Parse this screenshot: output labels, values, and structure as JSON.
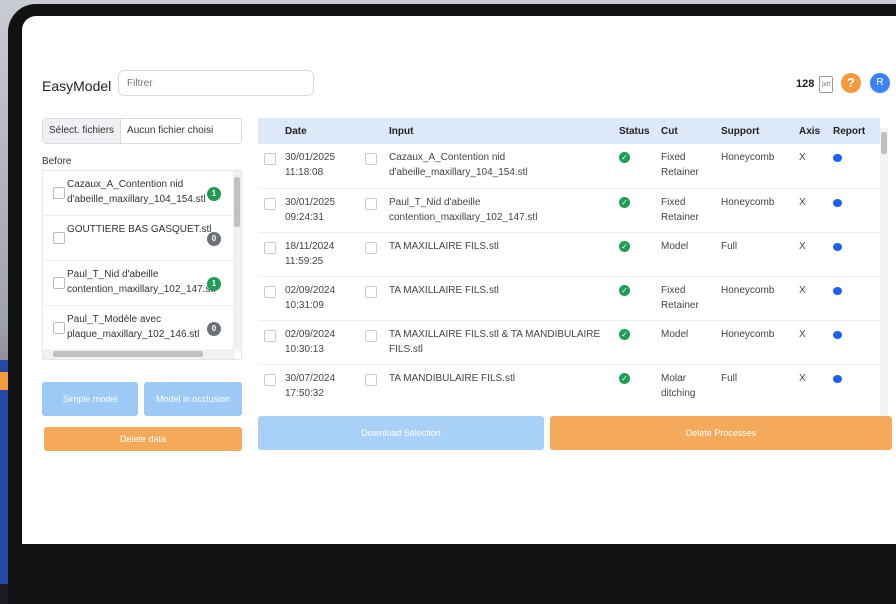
{
  "header": {
    "app_title": "EasyModel",
    "filter_placeholder": "Filtrer",
    "credits": "128",
    "pdf_icon_label": "pdf",
    "help_label": "?",
    "avatar_initial": "R"
  },
  "left_panel": {
    "file_button": "Sélect. fichiers",
    "file_none": "Aucun fichier choisi",
    "before_label": "Before",
    "files": [
      {
        "name": "Cazaux_A_Contention nid d'abeille_maxillary_104_154.stl",
        "badge": "1",
        "badge_color": "#1f9d55"
      },
      {
        "name": "GOUTTIERE BAS GASQUET.stl",
        "badge": "0",
        "badge_color": "#6b6f76"
      },
      {
        "name": "Paul_T_Nid d'abeille contention_maxillary_102_147.stl",
        "badge": "1",
        "badge_color": "#1f9d55"
      },
      {
        "name": "Paul_T_Modèle avec plaque_maxillary_102_146.stl",
        "badge": "0",
        "badge_color": "#6b6f76"
      }
    ],
    "buttons": {
      "simple_model": "Simple model",
      "model_occlusion": "Model in occlusion",
      "delete_data": "Delete data"
    }
  },
  "table": {
    "headers": [
      "Date",
      "Input",
      "Status",
      "Cut",
      "Support",
      "Axis",
      "Report"
    ],
    "rows": [
      {
        "date": "30/01/2025",
        "time": "11:18:08",
        "input": "Cazaux_A_Contention nid d'abeille_maxillary_104_154.stl",
        "cut": "Fixed Retainer",
        "support": "Honeycomb",
        "axis": "X"
      },
      {
        "date": "30/01/2025",
        "time": "09:24:31",
        "input": "Paul_T_Nid d'abeille contention_maxillary_102_147.stl",
        "cut": "Fixed Retainer",
        "support": "Honeycomb",
        "axis": "X"
      },
      {
        "date": "18/11/2024",
        "time": "11:59:25",
        "input": "TA MAXILLAIRE FILS.stl",
        "cut": "Model",
        "support": "Full",
        "axis": "X"
      },
      {
        "date": "02/09/2024",
        "time": "10:31:09",
        "input": "TA MAXILLAIRE FILS.stl",
        "cut": "Fixed Retainer",
        "support": "Honeycomb",
        "axis": "X"
      },
      {
        "date": "02/09/2024",
        "time": "10:30:13",
        "input": "TA MAXILLAIRE FILS.stl & TA MANDIBULAIRE FILS.stl",
        "cut": "Model",
        "support": "Honeycomb",
        "axis": "X"
      },
      {
        "date": "30/07/2024",
        "time": "17:50:32",
        "input": "TA MANDIBULAIRE FILS.stl",
        "cut": "Molar ditching",
        "support": "Full",
        "axis": "X"
      }
    ]
  },
  "footer_buttons": {
    "download_selection": "Download Selection",
    "delete_processes": "Delete Processes"
  },
  "colors": {
    "accent_blue": "#3b82f6",
    "accent_orange": "#f39a3a",
    "status_ok": "#1f9d55"
  }
}
